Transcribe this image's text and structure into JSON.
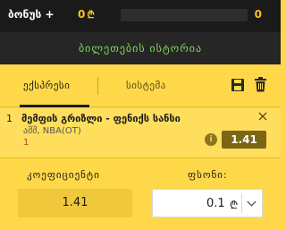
{
  "topbar": {
    "bonus_label": "ბონუს +",
    "bonus_amount": "0",
    "bonus_currency": "₾",
    "progress_fraction": 0,
    "bonus_right": "0"
  },
  "history": {
    "label": "ბილეთების ისტორია"
  },
  "tabs": {
    "express": "ექსპრესი",
    "system": "სისტემა",
    "active": "express"
  },
  "bet": {
    "index": "1",
    "title": "მემფის გრიზლი - ფენიქს სანსი",
    "league": "აშშ, NBA(OT)",
    "choice": "1",
    "odds": "1.41",
    "info_icon": "i"
  },
  "summary": {
    "coef_label": "კოეფიციენტი",
    "coef_value": "1.41",
    "stake_label": "ფსონი:",
    "stake_value": "0.1",
    "stake_currency": "₾"
  },
  "colors": {
    "accent_yellow": "#ffd84a",
    "dark": "#1a1a1a",
    "history_green": "#7ed957",
    "odds_badge": "#7a6614"
  }
}
